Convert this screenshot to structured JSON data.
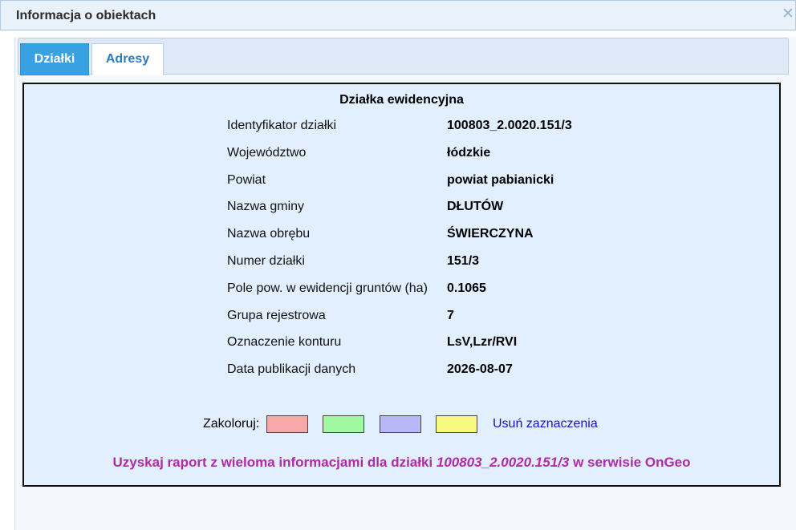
{
  "window": {
    "title": "Informacja o obiektach",
    "close_icon": "close-icon"
  },
  "tabs": [
    {
      "label": "Działki",
      "active": true
    },
    {
      "label": "Adresy",
      "active": false
    }
  ],
  "parcel": {
    "heading": "Działka ewidencyjna",
    "rows": [
      {
        "label": "Identyfikator działki",
        "value": "100803_2.0020.151/3"
      },
      {
        "label": "Województwo",
        "value": "łódzkie"
      },
      {
        "label": "Powiat",
        "value": "powiat pabianicki"
      },
      {
        "label": "Nazwa gminy",
        "value": "DŁUTÓW"
      },
      {
        "label": "Nazwa obrębu",
        "value": "ŚWIERCZYNA"
      },
      {
        "label": "Numer działki",
        "value": "151/3"
      },
      {
        "label": "Pole pow. w ewidencji gruntów (ha)",
        "value": "0.1065"
      },
      {
        "label": "Grupa rejestrowa",
        "value": "7"
      },
      {
        "label": "Oznaczenie konturu",
        "value": "LsV,Lzr/RVI"
      },
      {
        "label": "Data publikacji danych",
        "value": "2026-08-07"
      }
    ]
  },
  "colorize": {
    "label": "Zakoloruj:",
    "swatches": [
      "#f8a8a8",
      "#a0f8a0",
      "#b8b8f8",
      "#f8f880"
    ],
    "clear_label": "Usuń zaznaczenia"
  },
  "report": {
    "prefix": "Uzyskaj raport z wieloma informacjami dla działki ",
    "parcel_id": "100803_2.0020.151/3",
    "suffix": " w serwisie OnGeo"
  }
}
